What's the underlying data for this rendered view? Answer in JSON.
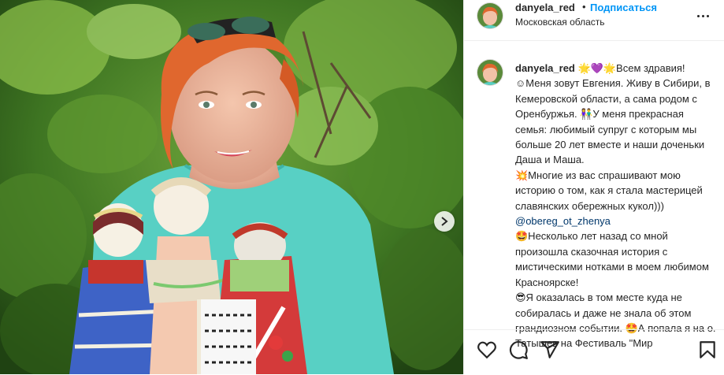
{
  "post": {
    "username": "danyela_red",
    "separator": "•",
    "follow_label": "Подписаться",
    "location": "Московская область"
  },
  "caption": {
    "username": "danyela_red",
    "p1": " 🌟💜🌟Всем здравия!\n☺Меня зовут Евгения. Живу в Сибири, в Кемеровской области, а сама родом с Оренбуржья. 👫У меня прекрасная семья: любимый супруг с которым мы больше 20 лет вместе и наши доченьки Даша и Маша.\n💥Многие из вас спрашивают мою историю о том, как я стала мастерицей славянских обережных кукол)))\n",
    "mention": "@obereg_ot_zhenya",
    "p2": "\n🤩Несколько лет назад со мной произошла сказочная история с мистическими нотками в моем любимом Красноярске!\n😎Я оказалась в том месте куда не собиралась и даже не знала об этом грандиозном событии. 🤩А попала я на о. Татышев на Фестиваль \"Мир"
  },
  "icons": {
    "like": "heart-icon",
    "comment": "comment-icon",
    "share": "share-icon",
    "save": "bookmark-icon",
    "more": "more-options-icon",
    "next": "chevron-right-icon"
  },
  "colors": {
    "link": "#0095f6",
    "mention": "#00376b",
    "text": "#262626",
    "border": "#efefef"
  }
}
